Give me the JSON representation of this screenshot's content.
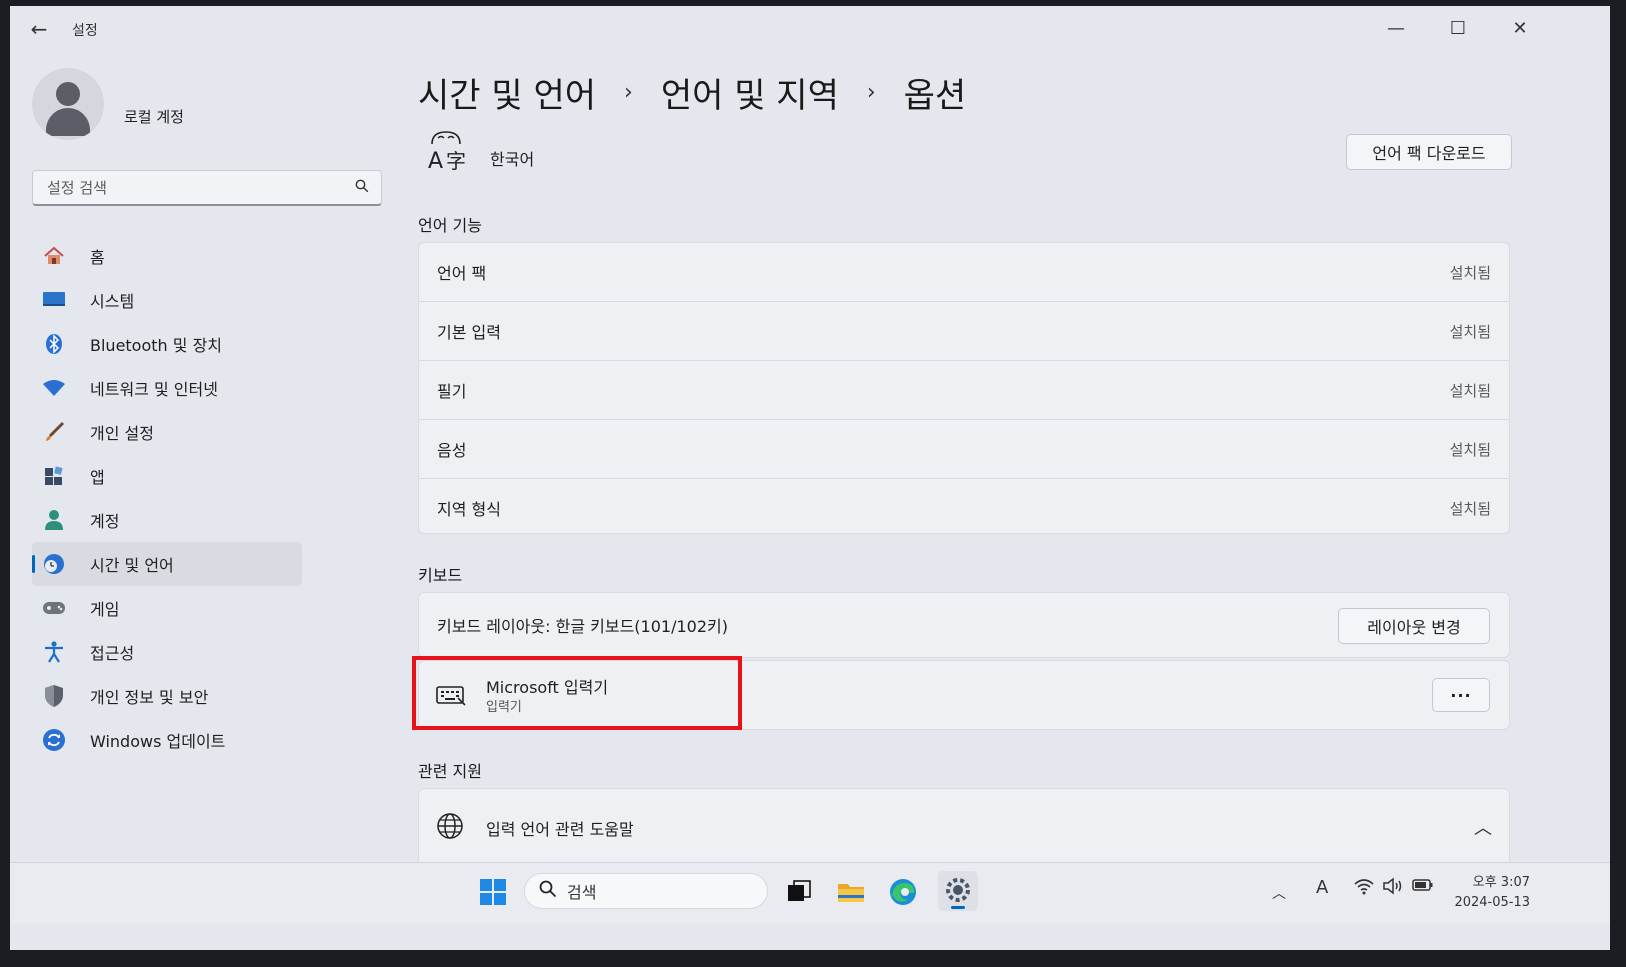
{
  "window": {
    "title": "설정"
  },
  "account": {
    "name": "로컬 계정"
  },
  "search": {
    "placeholder": "설정 검색"
  },
  "nav": {
    "items": [
      {
        "label": "홈"
      },
      {
        "label": "시스템"
      },
      {
        "label": "Bluetooth 및 장치"
      },
      {
        "label": "네트워크 및 인터넷"
      },
      {
        "label": "개인 설정"
      },
      {
        "label": "앱"
      },
      {
        "label": "계정"
      },
      {
        "label": "시간 및 언어"
      },
      {
        "label": "게임"
      },
      {
        "label": "접근성"
      },
      {
        "label": "개인 정보 및 보안"
      },
      {
        "label": "Windows 업데이트"
      }
    ],
    "active_index": 7
  },
  "breadcrumb": {
    "items": [
      "시간 및 언어",
      "언어 및 지역",
      "옵션"
    ]
  },
  "language": {
    "name": "한국어",
    "download_button": "언어 팩 다운로드"
  },
  "language_features": {
    "title": "언어 기능",
    "rows": [
      {
        "label": "언어 팩",
        "status": "설치됨"
      },
      {
        "label": "기본 입력",
        "status": "설치됨"
      },
      {
        "label": "필기",
        "status": "설치됨"
      },
      {
        "label": "음성",
        "status": "설치됨"
      },
      {
        "label": "지역 형식",
        "status": "설치됨"
      }
    ]
  },
  "keyboard": {
    "title": "키보드",
    "layout_label": "키보드 레이아웃: 한글 키보드(101/102키)",
    "change_layout_button": "레이아웃 변경",
    "ime_title": "Microsoft 입력기",
    "ime_subtitle": "입력기",
    "more_button": "···"
  },
  "related": {
    "title": "관련 지원",
    "help_label": "입력 언어 관련 도움말"
  },
  "taskbar": {
    "search_label": "검색",
    "ime_indicator": "A",
    "time": "오후 3:07",
    "date": "2024-05-13"
  },
  "colors": {
    "accent": "#0067c0",
    "highlight": "#e8121b"
  }
}
